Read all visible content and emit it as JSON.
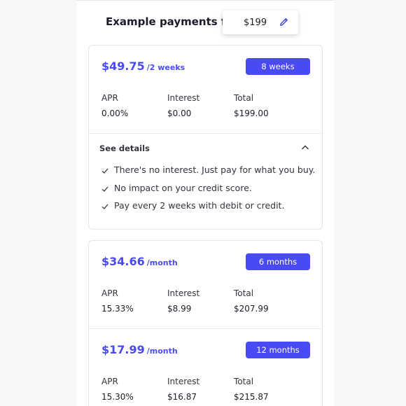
{
  "header": {
    "title": "Example payments for",
    "amount": "$199"
  },
  "labels": {
    "apr": "APR",
    "interest": "Interest",
    "total": "Total"
  },
  "plans": [
    {
      "price": "$49.75",
      "per": "/2 weeks",
      "term": "8 weeks",
      "apr": "0.00%",
      "interest": "$0.00",
      "total": "$199.00"
    },
    {
      "price": "$34.66",
      "per": "/month",
      "term": "6 months",
      "apr": "15.33%",
      "interest": "$8.99",
      "total": "$207.99"
    },
    {
      "price": "$17.99",
      "per": "/month",
      "term": "12 months",
      "apr": "15.30%",
      "interest": "$16.87",
      "total": "$215.87"
    }
  ],
  "details": {
    "label": "See details",
    "items": [
      "There's no interest. Just pay for what you buy.",
      "No impact on your credit score.",
      "Pay every 2 weeks with debit or credit."
    ]
  },
  "colors": {
    "accent": "#4a4af4",
    "text": "#1c1c28",
    "border": "#e4e4ea"
  }
}
